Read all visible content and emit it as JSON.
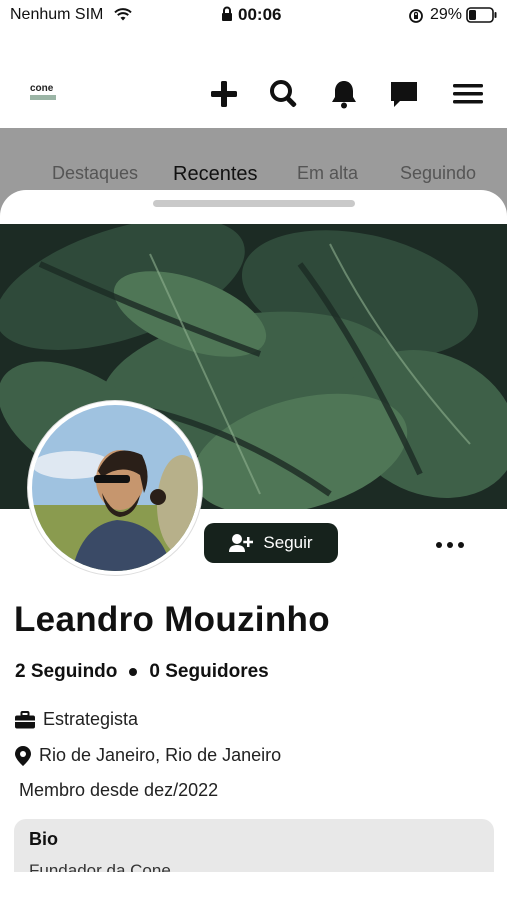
{
  "status_bar": {
    "carrier": "Nenhum SIM",
    "time": "00:06",
    "battery": "29%"
  },
  "header": {
    "logo_text": "cone",
    "icons": [
      "plus-icon",
      "search-icon",
      "bell-icon",
      "chat-icon",
      "menu-icon"
    ]
  },
  "tabs": [
    {
      "label": "Destaques",
      "active": false
    },
    {
      "label": "Recentes",
      "active": true
    },
    {
      "label": "Em alta",
      "active": false
    },
    {
      "label": "Seguindo",
      "active": false
    }
  ],
  "profile": {
    "follow_label": "Seguir",
    "name": "Leandro Mouzinho",
    "following": "2 Seguindo",
    "followers": "0 Seguidores",
    "role": "Estrategista",
    "location": "Rio de Janeiro, Rio de Janeiro",
    "member_since": "Membro desde dez/2022",
    "bio_title": "Bio",
    "bio_text": "Fundador da Cone"
  },
  "colors": {
    "accent": "#16221c",
    "backdrop": "#9b9b9b",
    "bio_bg": "#e8e8e8"
  }
}
